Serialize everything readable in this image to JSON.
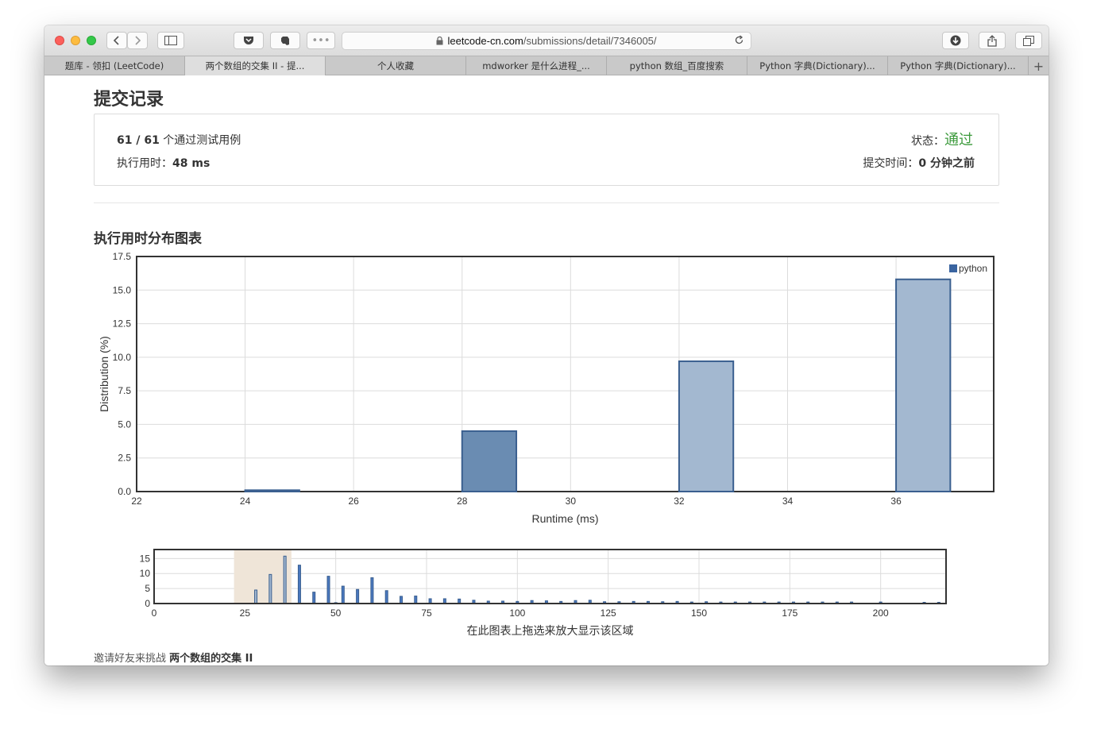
{
  "browser": {
    "url_host": "leetcode-cn.com",
    "url_path": "/submissions/detail/7346005/",
    "tabs": [
      {
        "label": "题库 - 领扣 (LeetCode)",
        "active": false
      },
      {
        "label": "两个数组的交集 II - 提...",
        "active": true
      },
      {
        "label": "个人收藏",
        "active": false
      },
      {
        "label": "mdworker 是什么进程_...",
        "active": false
      },
      {
        "label": "python 数组_百度搜索",
        "active": false
      },
      {
        "label": "Python 字典(Dictionary)...",
        "active": false
      },
      {
        "label": "Python 字典(Dictionary)...",
        "active": false
      }
    ],
    "new_tab": "+"
  },
  "page": {
    "title": "提交记录",
    "cases_passed": "61 / 61",
    "cases_text": "个通过测试用例",
    "runtime_label": "执行用时：",
    "runtime_value": "48 ms",
    "status_label": "状态：",
    "status_value": "通过",
    "submit_time_label": "提交时间：",
    "submit_time_value": "0 分钟之前",
    "section_title": "执行用时分布图表",
    "navigator_caption": "在此图表上拖选来放大显示该区域",
    "invite_text": "邀请好友来挑战",
    "invite_problem": "两个数组的交集 II"
  },
  "colors": {
    "status_green": "#3c9a3c",
    "bar_dark": "#6a8cb2",
    "bar_light": "#a3b8d0",
    "bar_stroke": "#3a5f8f",
    "nav_selection": "#efe5d8"
  },
  "chart_data": [
    {
      "type": "bar",
      "title": "",
      "xlabel": "Runtime (ms)",
      "ylabel": "Distribution (%)",
      "xlim": [
        22,
        37.8
      ],
      "ylim": [
        0,
        17.5
      ],
      "xticks": [
        22,
        24,
        26,
        28,
        30,
        32,
        34,
        36
      ],
      "yticks": [
        "0.0",
        "2.5",
        "5.0",
        "7.5",
        "10.0",
        "12.5",
        "15.0",
        "17.5"
      ],
      "grid": true,
      "legend": "top-right",
      "series": [
        {
          "name": "python",
          "bars": [
            {
              "x": 24,
              "value": 0.1,
              "highlight": true
            },
            {
              "x": 28,
              "value": 4.5,
              "highlight": true
            },
            {
              "x": 32,
              "value": 9.7,
              "highlight": false
            },
            {
              "x": 36,
              "value": 15.8,
              "highlight": false
            }
          ]
        }
      ]
    },
    {
      "type": "bar",
      "title": "",
      "xlabel": "在此图表上拖选来放大显示该区域",
      "xlim": [
        0,
        218
      ],
      "ylim": [
        0,
        18
      ],
      "xticks": [
        0,
        25,
        50,
        75,
        100,
        125,
        150,
        175,
        200
      ],
      "yticks": [
        0,
        5,
        10,
        15
      ],
      "selection": [
        22,
        37.8
      ],
      "values": [
        {
          "x": 24,
          "value": 0.1
        },
        {
          "x": 28,
          "value": 4.5
        },
        {
          "x": 32,
          "value": 9.7
        },
        {
          "x": 36,
          "value": 15.8
        },
        {
          "x": 40,
          "value": 12.8
        },
        {
          "x": 44,
          "value": 3.8
        },
        {
          "x": 48,
          "value": 9.1
        },
        {
          "x": 50,
          "value": 0.3
        },
        {
          "x": 52,
          "value": 5.8
        },
        {
          "x": 56,
          "value": 4.7
        },
        {
          "x": 60,
          "value": 8.6
        },
        {
          "x": 64,
          "value": 4.3
        },
        {
          "x": 68,
          "value": 2.4
        },
        {
          "x": 72,
          "value": 2.5
        },
        {
          "x": 76,
          "value": 1.6
        },
        {
          "x": 80,
          "value": 1.6
        },
        {
          "x": 84,
          "value": 1.5
        },
        {
          "x": 88,
          "value": 1.1
        },
        {
          "x": 92,
          "value": 0.8
        },
        {
          "x": 96,
          "value": 0.8
        },
        {
          "x": 100,
          "value": 0.7
        },
        {
          "x": 104,
          "value": 1.0
        },
        {
          "x": 108,
          "value": 0.9
        },
        {
          "x": 112,
          "value": 0.7
        },
        {
          "x": 116,
          "value": 1.0
        },
        {
          "x": 120,
          "value": 1.1
        },
        {
          "x": 124,
          "value": 0.6
        },
        {
          "x": 128,
          "value": 0.6
        },
        {
          "x": 132,
          "value": 0.7
        },
        {
          "x": 136,
          "value": 0.7
        },
        {
          "x": 140,
          "value": 0.6
        },
        {
          "x": 144,
          "value": 0.7
        },
        {
          "x": 148,
          "value": 0.5
        },
        {
          "x": 152,
          "value": 0.6
        },
        {
          "x": 156,
          "value": 0.5
        },
        {
          "x": 160,
          "value": 0.5
        },
        {
          "x": 164,
          "value": 0.5
        },
        {
          "x": 168,
          "value": 0.5
        },
        {
          "x": 172,
          "value": 0.5
        },
        {
          "x": 176,
          "value": 0.5
        },
        {
          "x": 180,
          "value": 0.5
        },
        {
          "x": 184,
          "value": 0.5
        },
        {
          "x": 188,
          "value": 0.5
        },
        {
          "x": 192,
          "value": 0.5
        },
        {
          "x": 200,
          "value": 0.5
        },
        {
          "x": 212,
          "value": 0.4
        },
        {
          "x": 216,
          "value": 0.4
        }
      ]
    }
  ]
}
